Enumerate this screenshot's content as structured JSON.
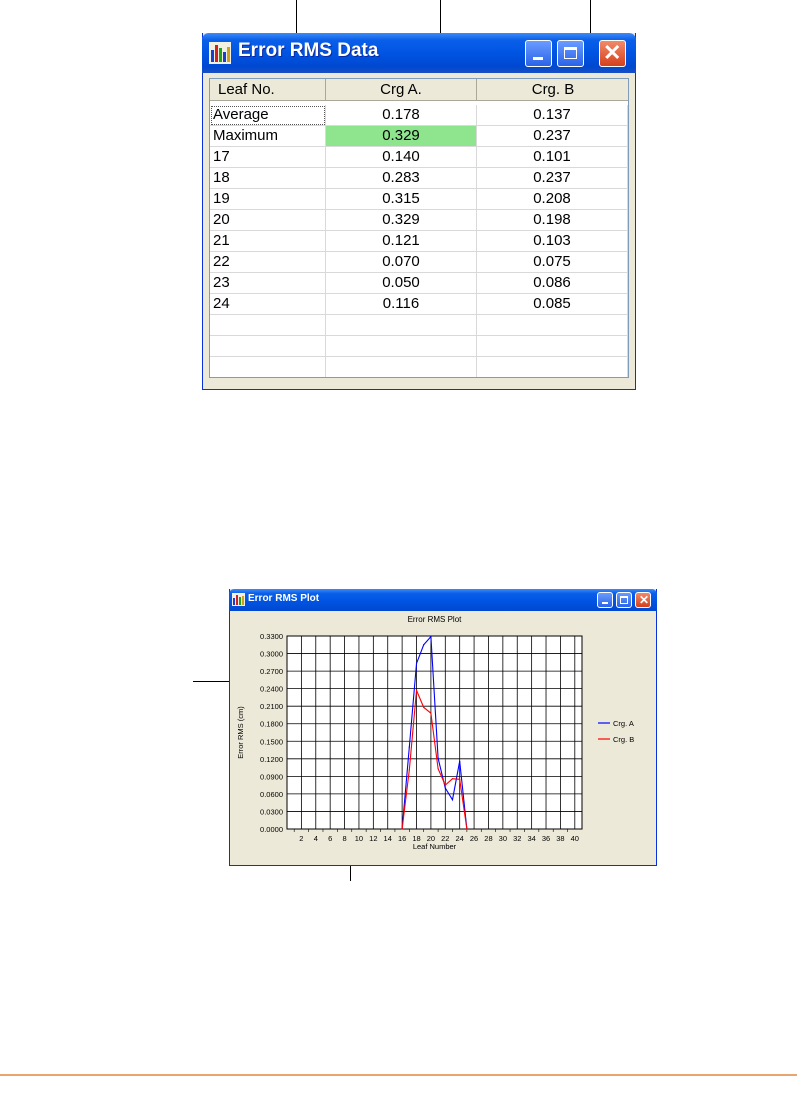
{
  "data_window": {
    "title": "Error RMS Data",
    "columns": [
      "Leaf No.",
      "Crg A.",
      "Crg. B"
    ],
    "rows": [
      [
        "Average",
        "0.178",
        "0.137"
      ],
      [
        "Maximum",
        "0.329",
        "0.237"
      ],
      [
        "17",
        "0.140",
        "0.101"
      ],
      [
        "18",
        "0.283",
        "0.237"
      ],
      [
        "19",
        "0.315",
        "0.208"
      ],
      [
        "20",
        "0.329",
        "0.198"
      ],
      [
        "21",
        "0.121",
        "0.103"
      ],
      [
        "22",
        "0.070",
        "0.075"
      ],
      [
        "23",
        "0.050",
        "0.086"
      ],
      [
        "24",
        "0.116",
        "0.085"
      ]
    ],
    "highlight_color": "#8ee58e"
  },
  "plot_window": {
    "title": "Error RMS Plot"
  },
  "chart_data": {
    "type": "line",
    "title": "Error RMS Plot",
    "xlabel": "Leaf Number",
    "ylabel": "Error RMS (cm)",
    "x_ticks": [
      2,
      4,
      6,
      8,
      10,
      12,
      14,
      16,
      18,
      20,
      22,
      24,
      26,
      28,
      30,
      32,
      34,
      36,
      38,
      40
    ],
    "y_ticks": [
      "0.0000",
      "0.0300",
      "0.0600",
      "0.0900",
      "0.1200",
      "0.1500",
      "0.1800",
      "0.2100",
      "0.2400",
      "0.2700",
      "0.3000",
      "0.3300"
    ],
    "xlim": [
      0,
      41
    ],
    "ylim": [
      0,
      0.33
    ],
    "grid": true,
    "legend_position": "right",
    "series": [
      {
        "name": "Crg. A",
        "color": "#0000ff",
        "x": [
          16,
          17,
          18,
          19,
          20,
          21,
          22,
          23,
          24,
          25
        ],
        "y": [
          0,
          0.14,
          0.283,
          0.315,
          0.329,
          0.121,
          0.07,
          0.05,
          0.116,
          0
        ]
      },
      {
        "name": "Crg. B",
        "color": "#ff0000",
        "x": [
          16,
          17,
          18,
          19,
          20,
          21,
          22,
          23,
          24,
          25
        ],
        "y": [
          0,
          0.101,
          0.237,
          0.208,
          0.198,
          0.103,
          0.075,
          0.086,
          0.085,
          0
        ]
      }
    ]
  }
}
